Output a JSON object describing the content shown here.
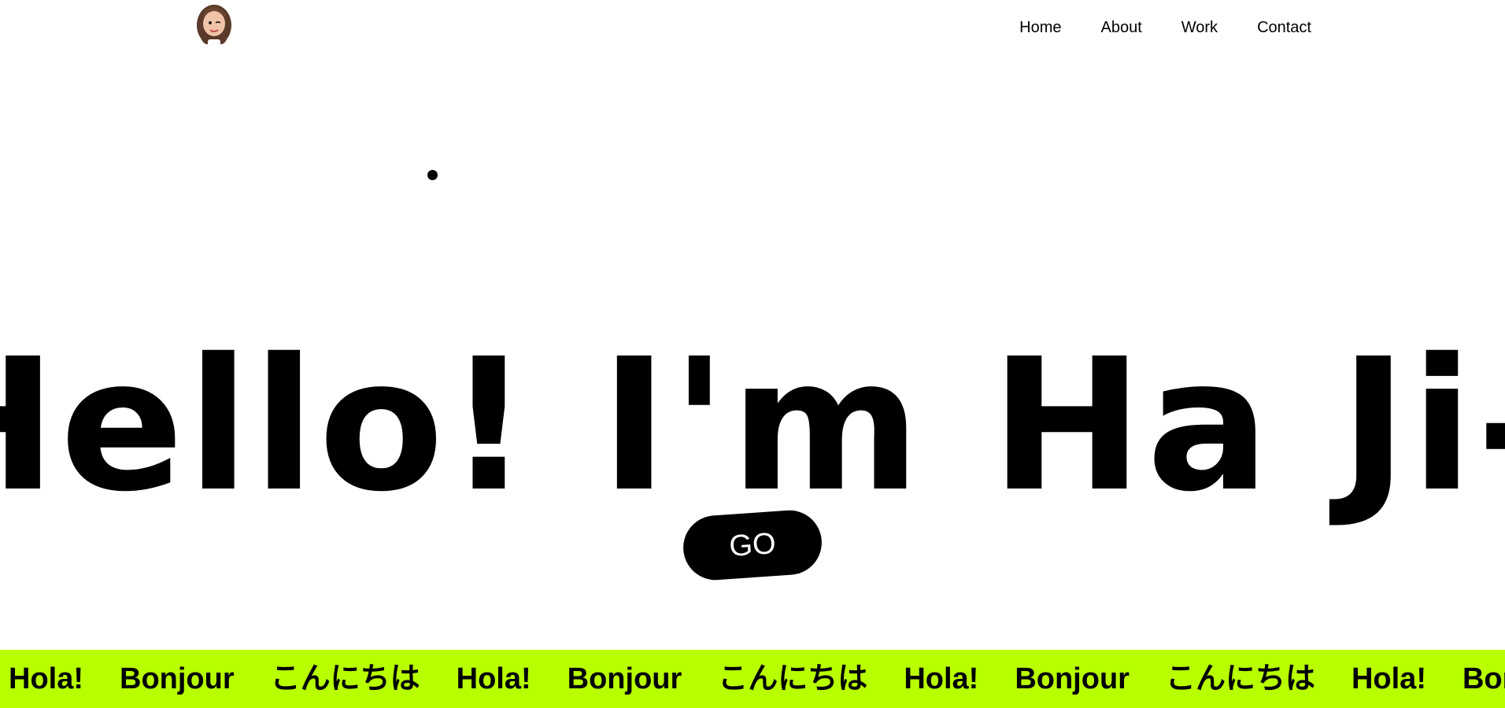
{
  "header": {
    "logo_icon": "memoji-avatar-icon",
    "nav": [
      {
        "label": "Home"
      },
      {
        "label": "About"
      },
      {
        "label": "Work"
      },
      {
        "label": "Contact"
      }
    ]
  },
  "hero": {
    "headline": "Hello! I'm Ha Ji-n",
    "cta_label": "GO"
  },
  "marquee": {
    "background_color": "#b8ff00",
    "items": [
      {
        "text": "Hola!"
      },
      {
        "text": "Bonjour"
      },
      {
        "text": "こんにちは"
      },
      {
        "text": "Hola!"
      },
      {
        "text": "Bonjour"
      },
      {
        "text": "こんにちは"
      },
      {
        "text": "Hola!"
      },
      {
        "text": "Bonjour"
      },
      {
        "text": "こんにちは"
      },
      {
        "text": "Hola!"
      },
      {
        "text": "Bonjour"
      }
    ]
  }
}
